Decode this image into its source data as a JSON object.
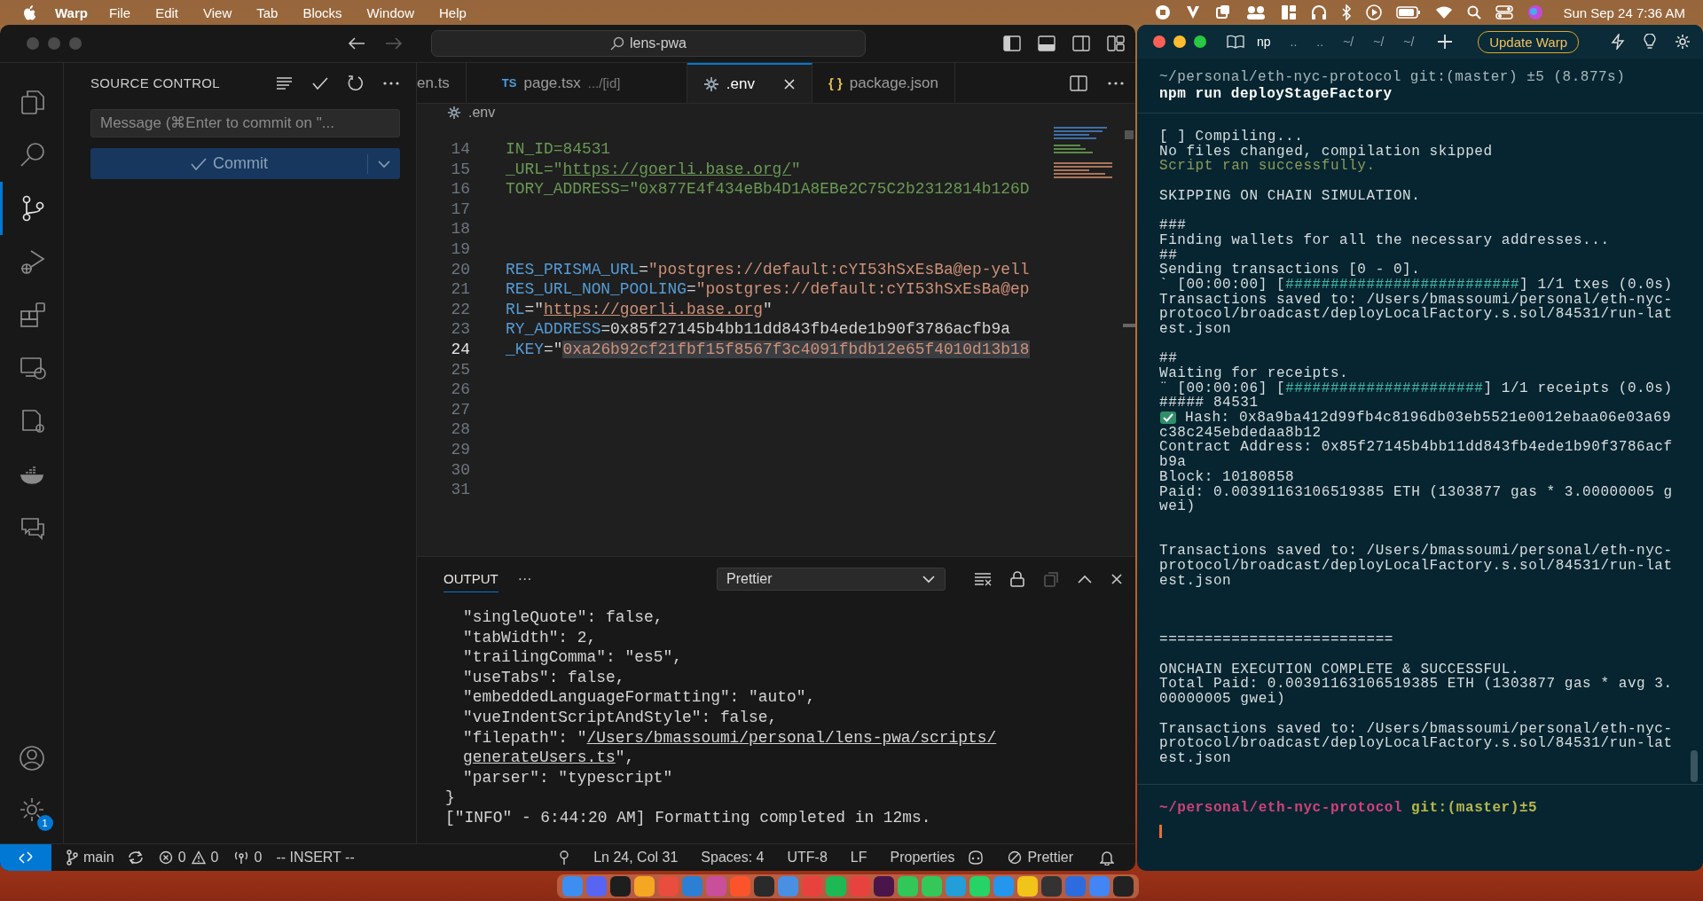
{
  "menubar": {
    "app": "Warp",
    "items": [
      "File",
      "Edit",
      "View",
      "Tab",
      "Blocks",
      "Window",
      "Help"
    ],
    "clock": "Sun Sep 24  7:36 AM"
  },
  "vscode": {
    "search": "lens-pwa",
    "activity": [
      {
        "kind": "explorer",
        "selected": false
      },
      {
        "kind": "search",
        "selected": false
      },
      {
        "kind": "scm",
        "selected": true
      },
      {
        "kind": "debug",
        "selected": false
      },
      {
        "kind": "extensions",
        "selected": false
      },
      {
        "kind": "remote",
        "selected": false
      },
      {
        "kind": "config",
        "selected": false
      },
      {
        "kind": "docker",
        "selected": false
      },
      {
        "kind": "chat",
        "selected": false
      }
    ],
    "settings_badge": "1",
    "sidebar": {
      "title": "SOURCE CONTROL",
      "placeholder": "Message (⌘Enter to commit on \"...",
      "commit": "Commit"
    },
    "tabs": [
      {
        "kind": "plain",
        "label": "en.ts",
        "selected": false
      },
      {
        "kind": "ts",
        "badge": "TS",
        "label": "page.tsx",
        "detail": ".../[id]",
        "selected": false
      },
      {
        "kind": "env",
        "label": ".env",
        "selected": true
      },
      {
        "kind": "json",
        "badge": "{ }",
        "label": "package.json",
        "selected": false
      }
    ],
    "breadcrumb": ".env",
    "lines": [
      {
        "number": "14",
        "current": false,
        "segments": [
          {
            "kind": "green",
            "text": "IN_ID=84531"
          }
        ]
      },
      {
        "number": "15",
        "current": false,
        "segments": [
          {
            "kind": "green",
            "text": "_URL=\""
          },
          {
            "kind": "green-link",
            "text": "https://goerli.base.org/"
          },
          {
            "kind": "green",
            "text": "\""
          }
        ]
      },
      {
        "number": "16",
        "current": false,
        "segments": [
          {
            "kind": "green",
            "text": "TORY_ADDRESS=\"0x877E4f434eBb4D1A8EBe2C75C2b2312814b126D"
          }
        ]
      },
      {
        "number": "17",
        "current": false
      },
      {
        "number": "18",
        "current": false
      },
      {
        "number": "19",
        "current": false
      },
      {
        "number": "20",
        "current": false,
        "segments": [
          {
            "kind": "key",
            "text": "RES_PRISMA_URL"
          },
          {
            "kind": "plain",
            "text": "="
          },
          {
            "kind": "string",
            "text": "\"postgres://default:cYI53hSxEsBa@ep-yell"
          }
        ]
      },
      {
        "number": "21",
        "current": false,
        "segments": [
          {
            "kind": "key",
            "text": "RES_URL_NON_POOLING"
          },
          {
            "kind": "plain",
            "text": "="
          },
          {
            "kind": "string",
            "text": "\"postgres://default:cYI53hSxEsBa@ep"
          }
        ]
      },
      {
        "number": "22",
        "current": false,
        "segments": [
          {
            "kind": "key",
            "text": "RL"
          },
          {
            "kind": "plain",
            "text": "=\""
          },
          {
            "kind": "string-link",
            "text": "https://goerli.base.org"
          },
          {
            "kind": "plain",
            "text": "\""
          }
        ]
      },
      {
        "number": "23",
        "current": false,
        "segments": [
          {
            "kind": "key",
            "text": "RY_ADDRESS"
          },
          {
            "kind": "plain",
            "text": "=0x85f27145b4bb11dd843fb4ede1b90f3786acfb9a"
          }
        ]
      },
      {
        "number": "24",
        "current": true,
        "segments": [
          {
            "kind": "key",
            "text": "_KEY"
          },
          {
            "kind": "plain",
            "text": "=\""
          },
          {
            "kind": "selected",
            "text": "0xa26b92cf21fbf15f8567f3c4091fbdb12e65f4010d13b18"
          }
        ]
      },
      {
        "number": "25",
        "current": false
      },
      {
        "number": "26",
        "current": false
      },
      {
        "number": "27",
        "current": false
      },
      {
        "number": "28",
        "current": false
      },
      {
        "number": "29",
        "current": false
      },
      {
        "number": "30",
        "current": false
      },
      {
        "number": "31",
        "current": false
      }
    ],
    "output": {
      "tab": "OUTPUT",
      "more": "···",
      "channel": "Prettier",
      "entries": [
        {
          "segments": [
            {
              "kind": "plain",
              "text": "\"singleQuote\": false,"
            }
          ]
        },
        {
          "segments": [
            {
              "kind": "plain",
              "text": "\"tabWidth\": 2,"
            }
          ]
        },
        {
          "segments": [
            {
              "kind": "plain",
              "text": "\"trailingComma\": \"es5\","
            }
          ]
        },
        {
          "segments": [
            {
              "kind": "plain",
              "text": "\"useTabs\": false,"
            }
          ]
        },
        {
          "segments": [
            {
              "kind": "plain",
              "text": "\"embeddedLanguageFormatting\": \"auto\","
            }
          ]
        },
        {
          "segments": [
            {
              "kind": "plain",
              "text": "\"vueIndentScriptAndStyle\": false,"
            }
          ]
        },
        {
          "segments": [
            {
              "kind": "plain",
              "text": "\"filepath\": \""
            },
            {
              "kind": "link",
              "text": "/Users/bmassoumi/personal/lens-pwa/scripts/"
            }
          ]
        },
        {
          "segments": [
            {
              "kind": "link",
              "text": "generateUsers.ts"
            },
            {
              "kind": "plain",
              "text": "\","
            }
          ]
        },
        {
          "segments": [
            {
              "kind": "plain",
              "text": "\"parser\": \"typescript\""
            }
          ]
        }
      ],
      "lines": [
        "}",
        "[\"INFO\" - 6:44:20 AM] Formatting completed in 12ms."
      ]
    },
    "status": {
      "branch": "main",
      "errors": "0",
      "warnings": "0",
      "ports": "0",
      "mode": "-- INSERT --",
      "position": "Ln 24, Col 31",
      "spaces": "Spaces: 4",
      "encoding": "UTF-8",
      "eol": "LF",
      "language": "Properties",
      "formatter": "Prettier"
    }
  },
  "warp": {
    "tabs": [
      {
        "label": "np",
        "selected": true
      },
      {
        "label": "..",
        "selected": false
      },
      {
        "label": "..",
        "selected": false
      },
      {
        "label": "~/",
        "selected": false
      },
      {
        "label": "~/",
        "selected": false
      },
      {
        "label": "~/",
        "selected": false
      }
    ],
    "update_button": "Update Warp",
    "block": {
      "header": "~/personal/eth-nyc-protocol git:(master) ±5 (8.877s)",
      "command": "npm run deployStageFactory"
    },
    "lines": [
      {
        "kind": "plain",
        "text": "[ ] Compiling..."
      },
      {
        "kind": "plain",
        "text": "No files changed, compilation skipped"
      },
      {
        "kind": "success",
        "text": "Script ran successfully."
      },
      {
        "kind": "blank"
      },
      {
        "kind": "plain",
        "text": "SKIPPING ON CHAIN SIMULATION."
      },
      {
        "kind": "blank"
      },
      {
        "kind": "plain",
        "text": "###"
      },
      {
        "kind": "plain",
        "text": "Finding wallets for all the necessary addresses..."
      },
      {
        "kind": "plain",
        "text": "##"
      },
      {
        "kind": "plain",
        "text": "Sending transactions [0 - 0]."
      },
      {
        "kind": "progress",
        "lead": "` [00:00:00] [",
        "bar": "##########################",
        "tail": "] 1/1 txes (0.0s)"
      },
      {
        "kind": "plain",
        "text": "Transactions saved to: /Users/bmassoumi/personal/eth-nyc-"
      },
      {
        "kind": "plain",
        "text": "protocol/broadcast/deployLocalFactory.s.sol/84531/run-lat"
      },
      {
        "kind": "plain",
        "text": "est.json"
      },
      {
        "kind": "blank"
      },
      {
        "kind": "plain",
        "text": "##"
      },
      {
        "kind": "plain",
        "text": "Waiting for receipts."
      },
      {
        "kind": "progress",
        "lead": "¨ [00:00:06] [",
        "bar": "######################",
        "tail": "] 1/1 receipts (0.0s)"
      },
      {
        "kind": "plain",
        "text": "##### 84531"
      },
      {
        "kind": "check",
        "text": "Hash: 0x8a9ba412d99fb4c8196db03eb5521e0012ebaa06e03a69"
      },
      {
        "kind": "plain",
        "text": "c38c245ebdedaa8b12"
      },
      {
        "kind": "plain",
        "text": "Contract Address: 0x85f27145b4bb11dd843fb4ede1b90f3786acf"
      },
      {
        "kind": "plain",
        "text": "b9a"
      },
      {
        "kind": "plain",
        "text": "Block: 10180858"
      },
      {
        "kind": "plain",
        "text": "Paid: 0.00391163106519385 ETH (1303877 gas * 3.00000005 g"
      },
      {
        "kind": "plain",
        "text": "wei)"
      },
      {
        "kind": "blank"
      },
      {
        "kind": "blank"
      },
      {
        "kind": "plain",
        "text": "Transactions saved to: /Users/bmassoumi/personal/eth-nyc-"
      },
      {
        "kind": "plain",
        "text": "protocol/broadcast/deployLocalFactory.s.sol/84531/run-lat"
      },
      {
        "kind": "plain",
        "text": "est.json"
      },
      {
        "kind": "blank"
      },
      {
        "kind": "blank"
      },
      {
        "kind": "blank"
      },
      {
        "kind": "plain",
        "text": "=========================="
      },
      {
        "kind": "blank"
      },
      {
        "kind": "plain",
        "text": "ONCHAIN EXECUTION COMPLETE & SUCCESSFUL."
      },
      {
        "kind": "plain",
        "text": "Total Paid: 0.00391163106519385 ETH (1303877 gas * avg 3."
      },
      {
        "kind": "plain",
        "text": "00000005 gwei)"
      },
      {
        "kind": "blank"
      },
      {
        "kind": "plain",
        "text": "Transactions saved to: /Users/bmassoumi/personal/eth-nyc-"
      },
      {
        "kind": "plain",
        "text": "protocol/broadcast/deployLocalFactory.s.sol/84531/run-lat"
      },
      {
        "kind": "plain",
        "text": "est.json"
      }
    ],
    "prompt": {
      "path": "~/personal/eth-nyc-protocol",
      "git": "git:(master)±5"
    }
  }
}
